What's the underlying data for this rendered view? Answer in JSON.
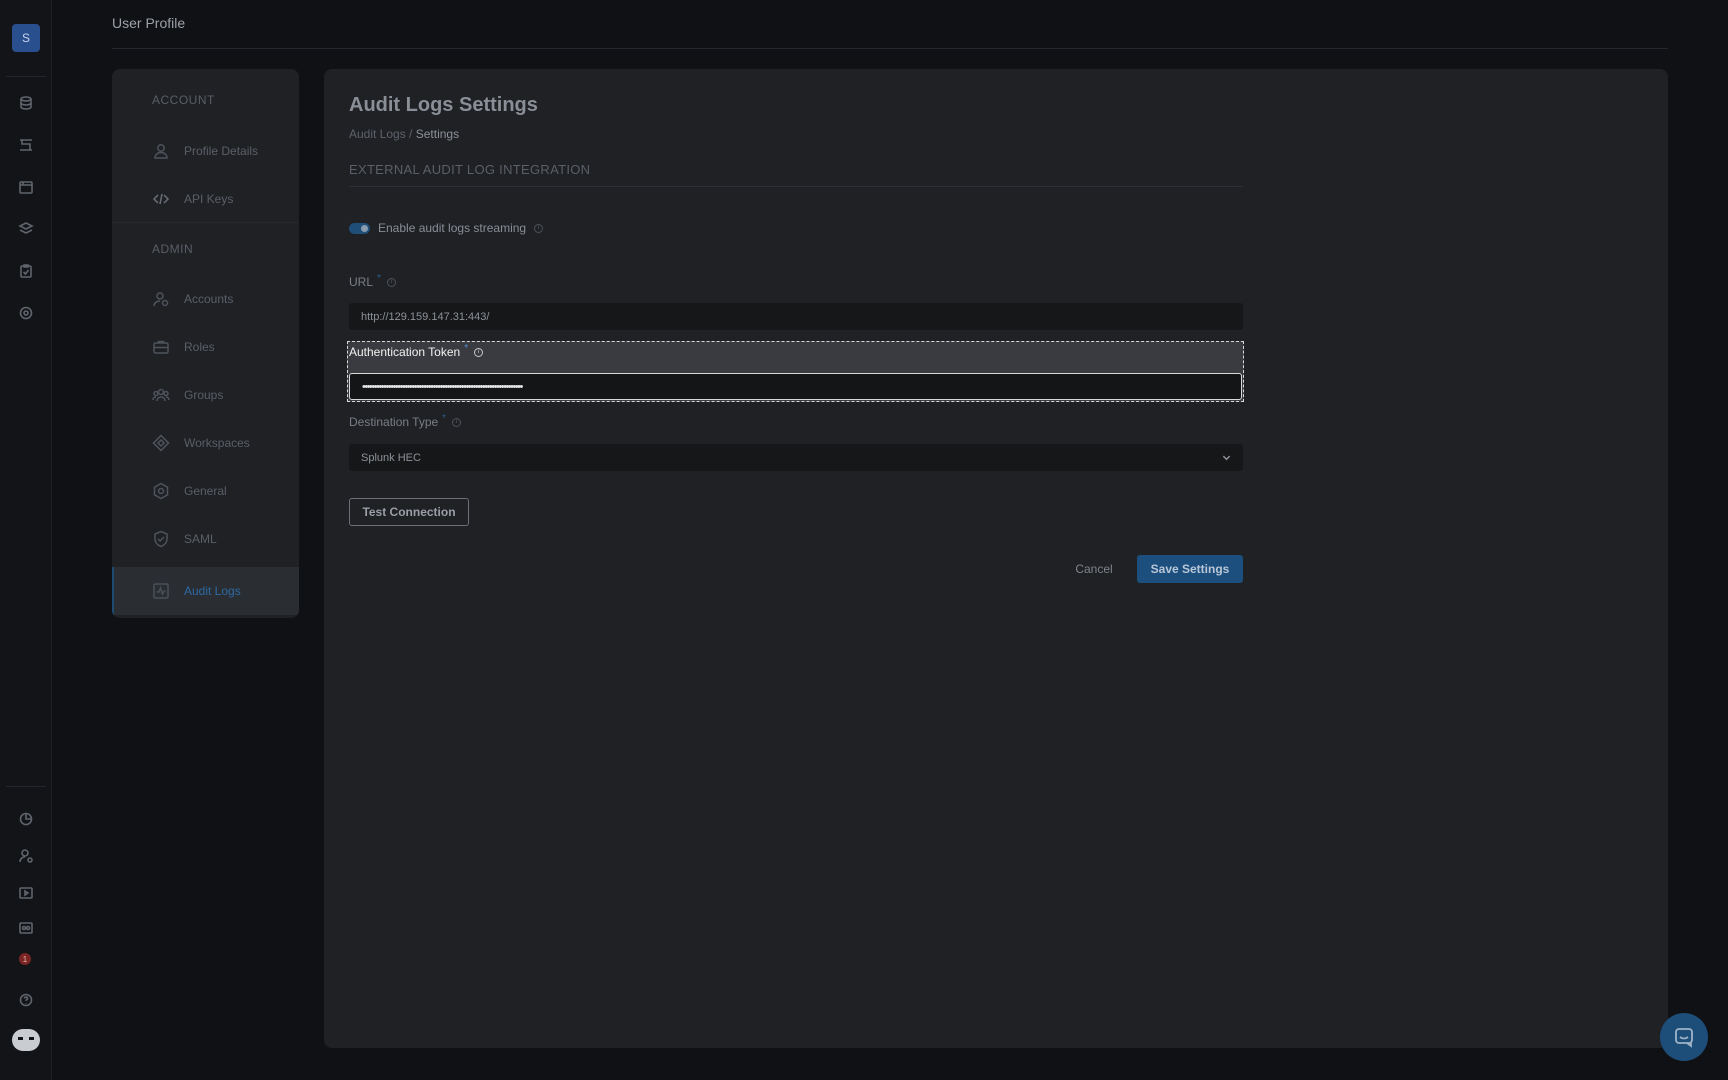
{
  "rail": {
    "avatar_letter": "S",
    "top_icons": [
      "database-icon",
      "pipeline-icon",
      "calendar-icon",
      "layers-icon",
      "clipboard-icon",
      "target-icon"
    ],
    "bottom_icons": [
      "pie-chart-icon",
      "user-settings-icon",
      "play-box-icon",
      "server-icon",
      "notification-icon",
      "help-icon",
      "chatbot-icon"
    ],
    "notification_count": "1"
  },
  "header": {
    "title": "User Profile"
  },
  "nav": {
    "sections": [
      {
        "title": "ACCOUNT",
        "items": [
          {
            "label": "Profile Details",
            "icon": "user-icon"
          },
          {
            "label": "API Keys",
            "icon": "code-icon"
          }
        ]
      },
      {
        "title": "ADMIN",
        "items": [
          {
            "label": "Accounts",
            "icon": "accounts-icon"
          },
          {
            "label": "Roles",
            "icon": "briefcase-icon"
          },
          {
            "label": "Groups",
            "icon": "groups-icon"
          },
          {
            "label": "Workspaces",
            "icon": "diamond-icon"
          },
          {
            "label": "General",
            "icon": "gear-icon"
          },
          {
            "label": "SAML",
            "icon": "shield-icon"
          },
          {
            "label": "Audit Logs",
            "icon": "activity-icon",
            "active": true
          }
        ]
      }
    ]
  },
  "main": {
    "title": "Audit Logs Settings",
    "breadcrumb": {
      "parent": "Audit Logs",
      "separator": " / ",
      "current": "Settings"
    },
    "section_title": "EXTERNAL AUDIT LOG INTEGRATION",
    "streaming_toggle": {
      "label": "Enable audit logs streaming",
      "enabled": true
    },
    "url": {
      "label": "URL",
      "required_mark": "*",
      "value": "http://129.159.147.31:443/"
    },
    "token": {
      "label": "Authentication Token",
      "required_mark": "*",
      "value": "••••••••••••••••••••••••••••••••••••••••••••••••••••••••••••••••••••"
    },
    "destination": {
      "label": "Destination Type",
      "required_mark": "*",
      "value": "Splunk HEC"
    },
    "test_button": "Test Connection",
    "cancel_button": "Cancel",
    "save_button": "Save Settings"
  },
  "colors": {
    "accent": "#1d4f7e",
    "active_nav_text": "#2d6aa3",
    "focus_outline": "#d8d8d8"
  }
}
